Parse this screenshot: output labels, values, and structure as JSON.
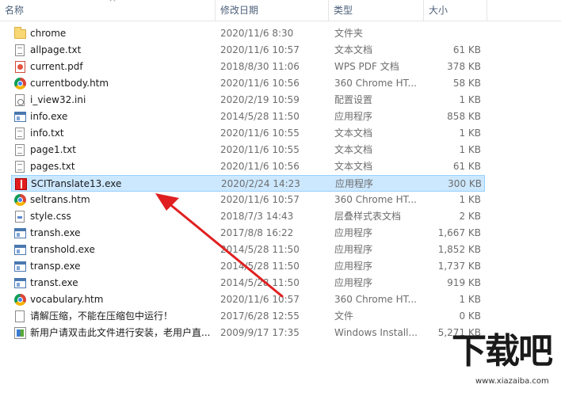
{
  "columns": {
    "name": "名称",
    "date": "修改日期",
    "type": "类型",
    "size": "大小"
  },
  "files": [
    {
      "name": "chrome",
      "date": "2020/11/6 8:30",
      "type": "文件夹",
      "size": "",
      "icon": "folder-icon"
    },
    {
      "name": "allpage.txt",
      "date": "2020/11/6 10:57",
      "type": "文本文档",
      "size": "61 KB",
      "icon": "text-file-icon"
    },
    {
      "name": "current.pdf",
      "date": "2018/8/30 11:06",
      "type": "WPS PDF 文档",
      "size": "378 KB",
      "icon": "pdf-file-icon"
    },
    {
      "name": "currentbody.htm",
      "date": "2020/11/6 10:56",
      "type": "360 Chrome HT...",
      "size": "58 KB",
      "icon": "chrome-html-icon"
    },
    {
      "name": "i_view32.ini",
      "date": "2020/2/19 10:59",
      "type": "配置设置",
      "size": "1 KB",
      "icon": "ini-file-icon"
    },
    {
      "name": "info.exe",
      "date": "2014/5/28 11:50",
      "type": "应用程序",
      "size": "858 KB",
      "icon": "exe-file-icon"
    },
    {
      "name": "info.txt",
      "date": "2020/11/6 10:55",
      "type": "文本文档",
      "size": "1 KB",
      "icon": "text-file-icon"
    },
    {
      "name": "page1.txt",
      "date": "2020/11/6 10:55",
      "type": "文本文档",
      "size": "1 KB",
      "icon": "text-file-icon"
    },
    {
      "name": "pages.txt",
      "date": "2020/11/6 10:56",
      "type": "文本文档",
      "size": "61 KB",
      "icon": "text-file-icon"
    },
    {
      "name": "SCITranslate13.exe",
      "date": "2020/2/24 14:23",
      "type": "应用程序",
      "size": "300 KB",
      "icon": "red-app-icon",
      "selected": true
    },
    {
      "name": "seltrans.htm",
      "date": "2020/11/6 10:57",
      "type": "360 Chrome HT...",
      "size": "1 KB",
      "icon": "chrome-html-icon"
    },
    {
      "name": "style.css",
      "date": "2018/7/3 14:43",
      "type": "层叠样式表文档",
      "size": "2 KB",
      "icon": "css-file-icon"
    },
    {
      "name": "transh.exe",
      "date": "2017/8/8 16:22",
      "type": "应用程序",
      "size": "1,667 KB",
      "icon": "exe-file-icon"
    },
    {
      "name": "transhold.exe",
      "date": "2014/5/28 11:50",
      "type": "应用程序",
      "size": "1,852 KB",
      "icon": "exe-file-icon"
    },
    {
      "name": "transp.exe",
      "date": "2014/5/28 11:50",
      "type": "应用程序",
      "size": "1,737 KB",
      "icon": "exe-file-icon"
    },
    {
      "name": "transt.exe",
      "date": "2014/5/28 11:50",
      "type": "应用程序",
      "size": "919 KB",
      "icon": "exe-file-icon"
    },
    {
      "name": "vocabulary.htm",
      "date": "2020/11/6 10:57",
      "type": "360 Chrome HT...",
      "size": "1 KB",
      "icon": "chrome-html-icon"
    },
    {
      "name": "请解压缩，不能在压缩包中运行！",
      "date": "2017/6/28 12:55",
      "type": "文件",
      "size": "0 KB",
      "icon": "blank-file-icon"
    },
    {
      "name": "新用户请双击此文件进行安装，老用户直...",
      "date": "2009/9/17 17:35",
      "type": "Windows Install...",
      "size": "5,271 KB",
      "icon": "installer-file-icon"
    }
  ],
  "annotation": {
    "color": "#e02020"
  },
  "watermark": {
    "title": "下载吧",
    "url": "www.xiazaiba.com"
  }
}
